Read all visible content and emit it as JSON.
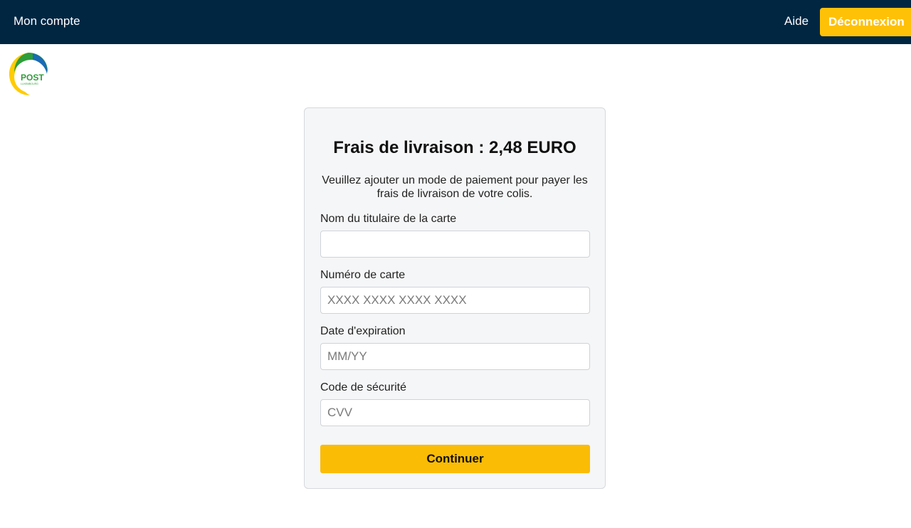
{
  "header": {
    "account_link": "Mon compte",
    "help_link": "Aide",
    "logout_button": "Déconnexion",
    "background_color": "#002642",
    "accent_color": "#ffc107"
  },
  "logo": {
    "icon": "post-luxembourg-logo",
    "text": "POST",
    "subtext": "LUXEMBOURG"
  },
  "form": {
    "title": "Frais de livraison : 2,48 EURO",
    "intro": "Veuillez ajouter un mode de paiement pour payer les frais de livraison de votre colis.",
    "fields": [
      {
        "label": "Nom du titulaire de la carte",
        "value": "",
        "placeholder": ""
      },
      {
        "label": "Numéro de carte",
        "value": "",
        "placeholder": "XXXX XXXX XXXX XXXX"
      },
      {
        "label": "Date d'expiration",
        "value": "",
        "placeholder": "MM/YY"
      },
      {
        "label": "Code de sécurité",
        "value": "",
        "placeholder": "CVV"
      }
    ],
    "submit_label": "Continuer",
    "submit_color": "#fbbc05"
  }
}
